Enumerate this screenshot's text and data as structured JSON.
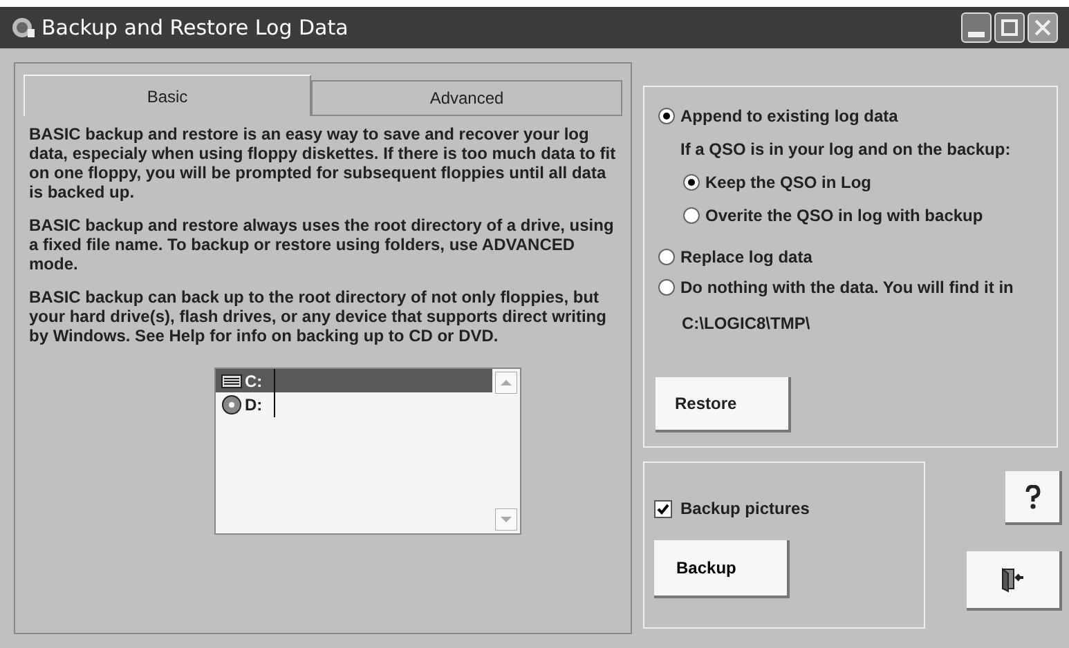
{
  "window": {
    "title": "Backup and Restore Log Data"
  },
  "tabs": [
    {
      "label": "Basic",
      "selected": true
    },
    {
      "label": "Advanced",
      "selected": false
    }
  ],
  "basic_text": [
    "BASIC backup and restore is an easy way to save and recover your log data, especialy when using floppy diskettes.  If there is too much data to fit on one floppy, you will be prompted for subsequent floppies until all data is backed up.",
    "BASIC backup and restore always uses the root directory of a drive, using a fixed file name.  To  backup or restore using folders, use ADVANCED mode.",
    "BASIC backup can back up to the root directory of not only floppies, but your hard drive(s), flash drives, or any device that supports direct writing by Windows. See Help for info on backing up to CD or DVD."
  ],
  "drives": [
    {
      "label": "C:",
      "kind": "hard-drive",
      "selected": true
    },
    {
      "label": "D:",
      "kind": "disc",
      "selected": false
    }
  ],
  "restore_options": [
    {
      "label": "Append to existing log data",
      "selected": true
    },
    {
      "label": "Replace log data",
      "selected": false
    },
    {
      "label": "Do nothing with the data. You will find it in",
      "selected": false
    }
  ],
  "append_hint": "If a QSO is in your log and on the backup:",
  "append_options": [
    {
      "label": "Keep the QSO in Log",
      "selected": true
    },
    {
      "label": "Overite the QSO in log with backup",
      "selected": false
    }
  ],
  "tmp_path": "C:\\LOGIC8\\TMP\\",
  "restore_button": "Restore",
  "backup_pictures": {
    "label": "Backup pictures",
    "checked": true
  },
  "backup_button": "Backup"
}
